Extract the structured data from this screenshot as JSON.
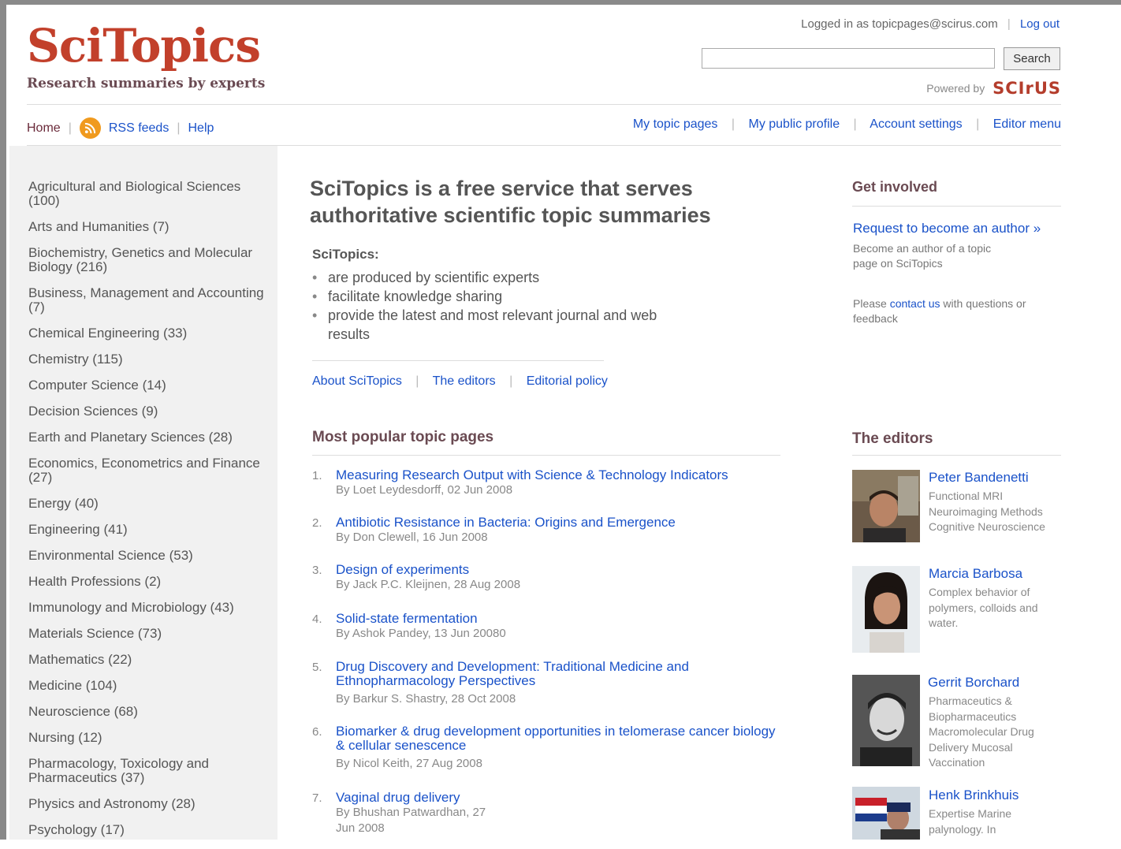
{
  "brand": {
    "logo": "SciTopics",
    "tagline": "Research summaries by experts",
    "powered_by": "Powered by",
    "powered_brand": "SCIrUS"
  },
  "account": {
    "logged_in_prefix": "Logged in as",
    "email": "topicpages@scirus.com",
    "logout": "Log out"
  },
  "search": {
    "value": "",
    "button": "Search"
  },
  "nav_left": {
    "home": "Home",
    "rss": "RSS feeds",
    "help": "Help"
  },
  "nav_right": {
    "my_topic_pages": "My topic pages",
    "my_public_profile": "My public profile",
    "account_settings": "Account settings",
    "editor_menu": "Editor menu"
  },
  "categories": [
    "Agricultural and Biological Sciences (100)",
    "Arts and Humanities (7)",
    "Biochemistry, Genetics and Molecular Biology (216)",
    "Business, Management and Accounting (7)",
    "Chemical Engineering (33)",
    "Chemistry (115)",
    "Computer Science (14)",
    "Decision Sciences (9)",
    "Earth and Planetary Sciences (28)",
    "Economics, Econometrics and Finance (27)",
    "Energy (40)",
    "Engineering (41)",
    "Environmental Science (53)",
    "Health Professions (2)",
    "Immunology and Microbiology (43)",
    "Materials Science (73)",
    "Mathematics (22)",
    "Medicine (104)",
    "Neuroscience (68)",
    "Nursing (12)",
    "Pharmacology, Toxicology and Pharmaceutics (37)",
    "Physics and Astronomy (28)",
    "Psychology (17)"
  ],
  "intro": {
    "title": "SciTopics is a free service that serves authoritative scientific topic summaries",
    "label": "SciTopics:",
    "bullets": [
      "are produced by scientific experts",
      "facilitate knowledge sharing",
      "provide the latest and most relevant journal and web results"
    ],
    "links": {
      "about": "About SciTopics",
      "editors": "The editors",
      "policy": "Editorial policy"
    }
  },
  "popular": {
    "heading": "Most popular topic pages",
    "items": [
      {
        "num": "1.",
        "title": "Measuring Research Output with Science & Technology Indicators",
        "byline": "By Loet Leydesdorff, 02 Jun 2008"
      },
      {
        "num": "2.",
        "title": "Antibiotic Resistance in Bacteria: Origins and Emergence",
        "byline": "By Don Clewell, 16 Jun 2008"
      },
      {
        "num": "3.",
        "title": "Design of experiments",
        "byline": "By Jack P.C. Kleijnen, 28 Aug 2008"
      },
      {
        "num": "4.",
        "title": "Solid-state fermentation",
        "byline": "By Ashok Pandey, 13 Jun 20080"
      },
      {
        "num": "5.",
        "title": "Drug Discovery and Development: Traditional Medicine and Ethnopharmacology Perspectives",
        "byline": "By Barkur S. Shastry, 28 Oct 2008"
      },
      {
        "num": "6.",
        "title": "Biomarker & drug development opportunities in telomerase cancer biology & cellular senescence",
        "byline": "By Nicol Keith, 27 Aug 2008"
      },
      {
        "num": "7.",
        "title": "Vaginal drug delivery",
        "byline": "By Bhushan Patwardhan, 27 Jun 2008"
      }
    ]
  },
  "get_involved": {
    "heading": "Get involved",
    "request_link": "Request to become an author »",
    "request_desc": "Become an author of a topic page on SciTopics",
    "contact_prefix": "Please",
    "contact_link": "contact us",
    "contact_suffix": "with questions or feedback"
  },
  "editors": {
    "heading": "The editors",
    "items": [
      {
        "name": "Peter Bandenetti",
        "desc": "Functional MRI Neuroimaging Methods Cognitive Neuroscience"
      },
      {
        "name": "Marcia Barbosa",
        "desc": "Complex behavior of polymers, colloids and water."
      },
      {
        "name": "Gerrit Borchard",
        "desc": "Pharmaceutics & Biopharmaceutics Macromolecular Drug Delivery Mucosal Vaccination"
      },
      {
        "name": "Henk Brinkhuis",
        "desc": "Expertise Marine palynology. In"
      }
    ]
  }
}
